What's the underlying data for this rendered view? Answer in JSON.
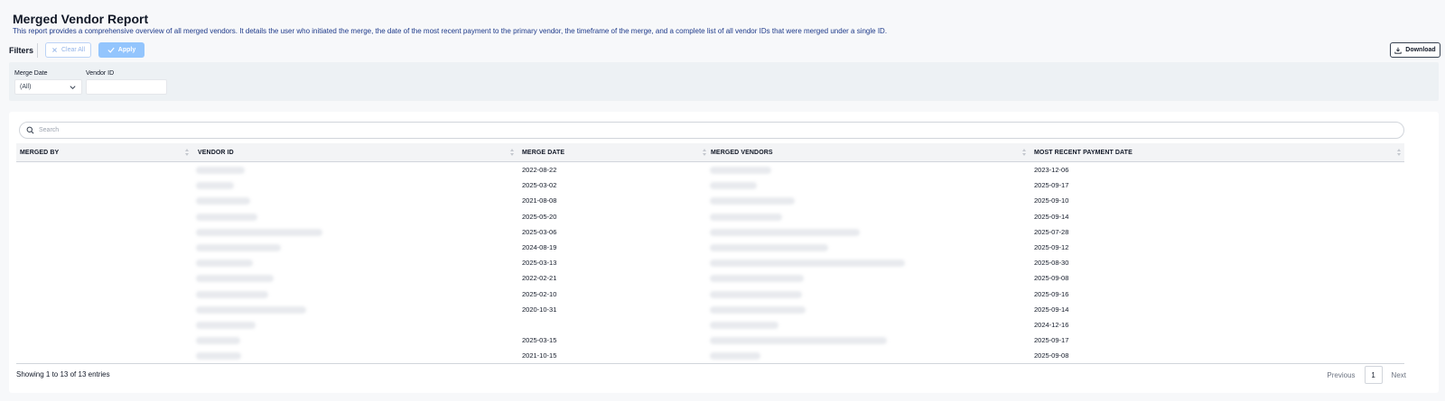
{
  "page": {
    "title": "Merged Vendor Report",
    "description": "This report provides a comprehensive overview of all merged vendors. It details the user who initiated the merge, the date of the most recent payment to the primary vendor, the timeframe of the merge, and a complete list of all vendor IDs that were merged under a single ID."
  },
  "toolbar": {
    "filters_label": "Filters",
    "clear_all_label": "Clear All",
    "apply_label": "Apply",
    "download_label": "Download"
  },
  "filters": {
    "merge_date_label": "Merge Date",
    "merge_date_value": "(All)",
    "vendor_id_label": "Vendor ID",
    "vendor_id_value": ""
  },
  "table": {
    "search_placeholder": "Search",
    "columns": [
      "MERGED BY",
      "VENDOR ID",
      "MERGE DATE",
      "MERGED VENDORS",
      "MOST RECENT PAYMENT DATE"
    ],
    "rows": [
      {
        "merge_date": "2022-08-22",
        "payment_date": "2023-12-06"
      },
      {
        "merge_date": "2025-03-02",
        "payment_date": "2025-09-17"
      },
      {
        "merge_date": "2021-08-08",
        "payment_date": "2025-09-10"
      },
      {
        "merge_date": "2025-05-20",
        "payment_date": "2025-09-14"
      },
      {
        "merge_date": "2025-03-06",
        "payment_date": "2025-07-28"
      },
      {
        "merge_date": "2024-08-19",
        "payment_date": "2025-09-12"
      },
      {
        "merge_date": "2025-03-13",
        "payment_date": "2025-08-30"
      },
      {
        "merge_date": "2022-02-21",
        "payment_date": "2025-09-08"
      },
      {
        "merge_date": "2025-02-10",
        "payment_date": "2025-09-16"
      },
      {
        "merge_date": "2020-10-31",
        "payment_date": "2025-09-14"
      },
      {
        "merge_date": "",
        "payment_date": "2024-12-16"
      },
      {
        "merge_date": "2025-03-15",
        "payment_date": "2025-09-17"
      },
      {
        "merge_date": "2021-10-15",
        "payment_date": "2025-09-08"
      }
    ]
  },
  "footer": {
    "showing": "Showing 1 to 13 of 13 entries",
    "previous_label": "Previous",
    "page_number": "1",
    "next_label": "Next"
  },
  "colors": {
    "accent": "#93c5fd",
    "description_text": "#1e3a8a",
    "filter_panel_bg": "#edf1f4"
  }
}
